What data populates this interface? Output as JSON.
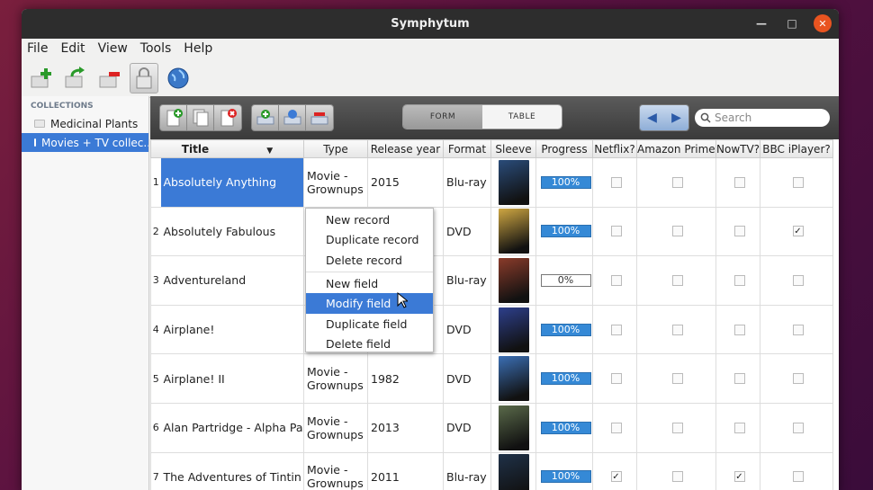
{
  "window": {
    "title": "Symphytum"
  },
  "menu": [
    "File",
    "Edit",
    "View",
    "Tools",
    "Help"
  ],
  "sidebar": {
    "header": "COLLECTIONS",
    "items": [
      {
        "label": "Medicinal Plants",
        "selected": false
      },
      {
        "label": "Movies + TV collec...",
        "selected": true
      }
    ]
  },
  "view_toggle": {
    "form": "FORM",
    "table": "TABLE",
    "active": "TABLE"
  },
  "search": {
    "placeholder": "Search"
  },
  "table": {
    "headers": [
      "Title",
      "Type",
      "Release year",
      "Format",
      "Sleeve",
      "Progress",
      "Netflix?",
      "Amazon Prime?",
      "NowTV?",
      "BBC iPlayer?"
    ],
    "rows": [
      {
        "num": "1",
        "title": "Absolutely Anything",
        "type": "Movie - Grownups",
        "year": "2015",
        "format": "Blu-ray",
        "progress": "100%",
        "progress_value": 1.0,
        "netflix": false,
        "amazon": false,
        "nowtv": false,
        "bbc": false,
        "sleeve_color": "#2a4c7a"
      },
      {
        "num": "2",
        "title": "Absolutely Fabulous",
        "type": "",
        "year": "",
        "format": "DVD",
        "progress": "100%",
        "progress_value": 1.0,
        "netflix": false,
        "amazon": false,
        "nowtv": false,
        "bbc": true,
        "sleeve_color": "#cfa742"
      },
      {
        "num": "3",
        "title": "Adventureland",
        "type": "",
        "year": "",
        "format": "Blu-ray",
        "progress": "0%",
        "progress_value": 0.0,
        "netflix": false,
        "amazon": false,
        "nowtv": false,
        "bbc": false,
        "sleeve_color": "#8a3b2a"
      },
      {
        "num": "4",
        "title": "Airplane!",
        "type": "",
        "year": "",
        "format": "DVD",
        "progress": "100%",
        "progress_value": 1.0,
        "netflix": false,
        "amazon": false,
        "nowtv": false,
        "bbc": false,
        "sleeve_color": "#2d3f8c"
      },
      {
        "num": "5",
        "title": "Airplane! II",
        "type": "Movie - Grownups",
        "year": "1982",
        "format": "DVD",
        "progress": "100%",
        "progress_value": 1.0,
        "netflix": false,
        "amazon": false,
        "nowtv": false,
        "bbc": false,
        "sleeve_color": "#3b6fb5"
      },
      {
        "num": "6",
        "title": "Alan Partridge - Alpha Papa",
        "type": "Movie - Grownups",
        "year": "2013",
        "format": "DVD",
        "progress": "100%",
        "progress_value": 1.0,
        "netflix": false,
        "amazon": false,
        "nowtv": false,
        "bbc": false,
        "sleeve_color": "#5a6a4a"
      },
      {
        "num": "7",
        "title": "The Adventures of Tintin",
        "type": "Movie - Grownups",
        "year": "2011",
        "format": "Blu-ray",
        "progress": "100%",
        "progress_value": 1.0,
        "netflix": true,
        "amazon": false,
        "nowtv": true,
        "bbc": false,
        "sleeve_color": "#1f3148"
      }
    ]
  },
  "context_menu": {
    "items": [
      "New record",
      "Duplicate record",
      "Delete record",
      "New field",
      "Modify field",
      "Duplicate field",
      "Delete field"
    ],
    "highlighted": "Modify field"
  },
  "colors": {
    "accent": "#3b7ad6",
    "progress": "#3589d6"
  }
}
